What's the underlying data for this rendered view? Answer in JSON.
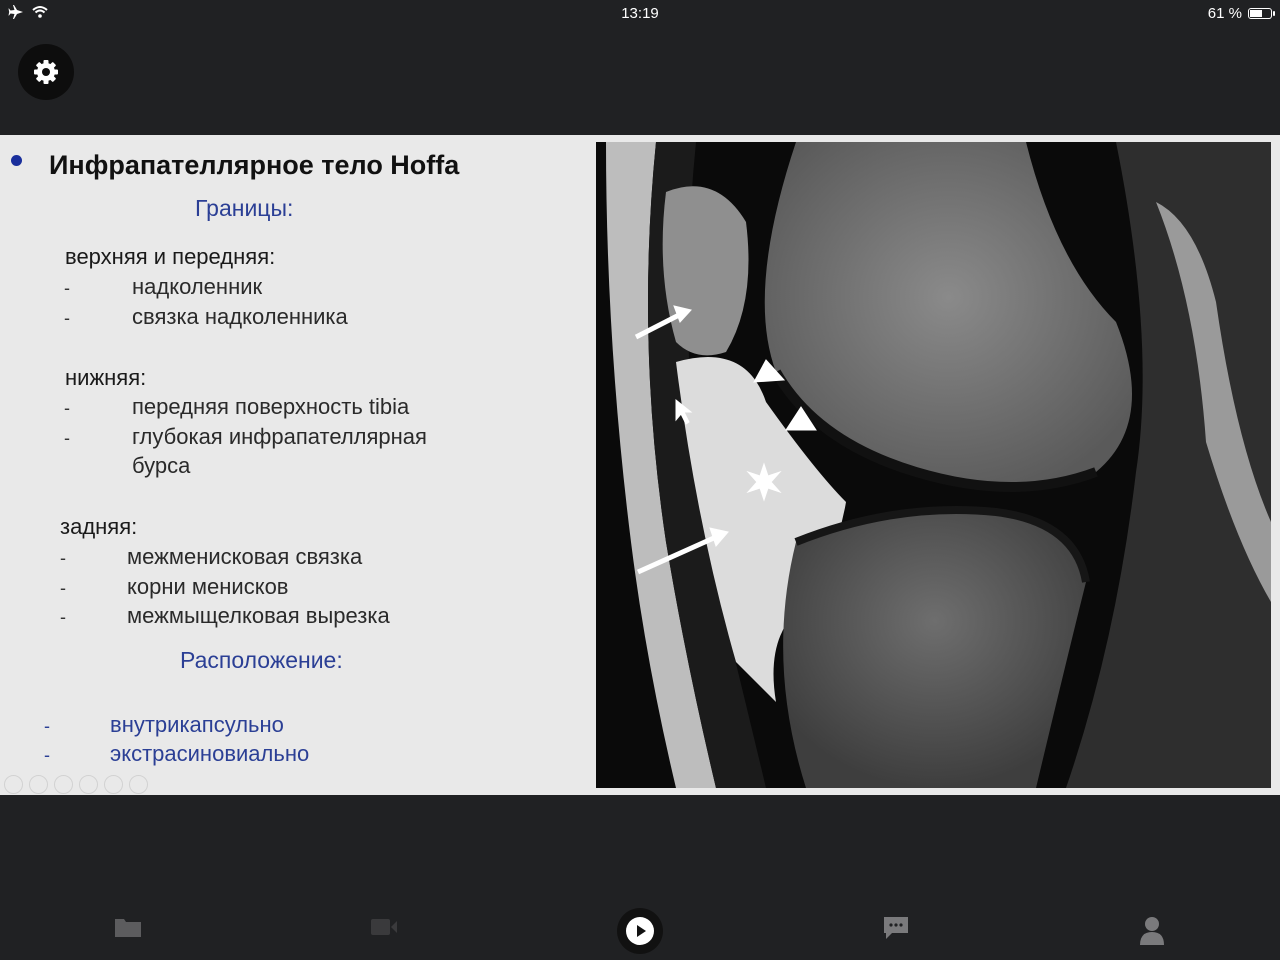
{
  "status_bar": {
    "time": "13:19",
    "battery_text": "61 %",
    "battery_level": 0.61
  },
  "settings_icon": "gear-icon",
  "slide": {
    "title": "Инфрапателлярное тело Hoffa",
    "borders_heading": "Границы:",
    "upper_front": {
      "heading": "верхняя и передняя:",
      "items": [
        "надколенник",
        "связка надколенника"
      ]
    },
    "lower": {
      "heading": "нижняя:",
      "items": [
        "передняя поверхность tibia",
        "глубокая инфрапателлярная",
        "бурса"
      ]
    },
    "posterior": {
      "heading": "задняя:",
      "items": [
        "межменисковая связка",
        "корни менисков",
        "межмыщелковая вырезка"
      ]
    },
    "location_heading": "Расположение:",
    "location_items": [
      "внутрикапсульно",
      "экстрасиновиально"
    ],
    "dash": "-"
  },
  "nav": {
    "icons": [
      "folder-icon",
      "video-camera-icon",
      "play-icon",
      "chat-icon",
      "person-icon"
    ]
  },
  "colors": {
    "background": "#202123",
    "slide_bg": "#e9e9e9",
    "accent_blue": "#2b3f95"
  }
}
